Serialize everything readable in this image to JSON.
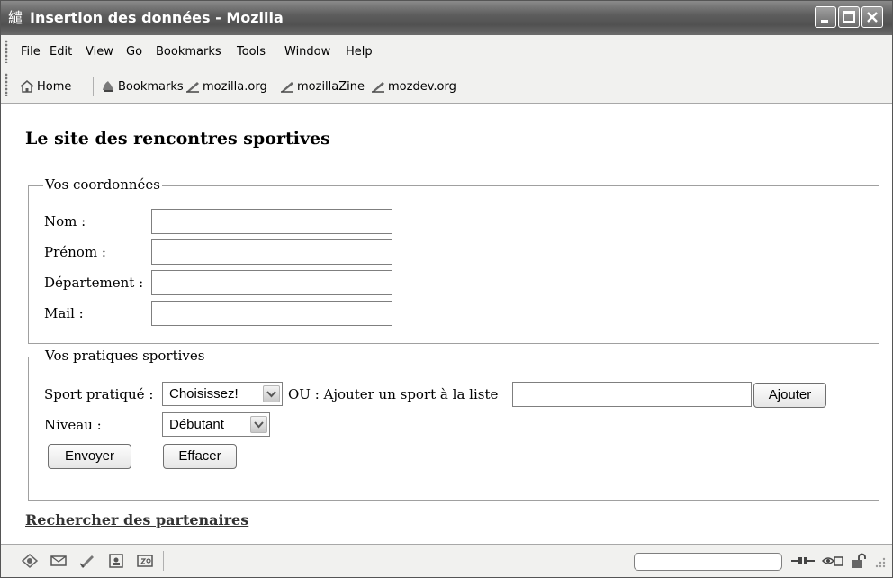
{
  "window": {
    "title": "Insertion des données - Mozilla"
  },
  "menubar": {
    "items": [
      "File",
      "Edit",
      "View",
      "Go",
      "Bookmarks",
      "Tools",
      "Window",
      "Help"
    ]
  },
  "toolbar": {
    "home": "Home",
    "bookmarks": "Bookmarks",
    "links": [
      "mozilla.org",
      "mozillaZine",
      "mozdev.org"
    ]
  },
  "page": {
    "title": "Le site des rencontres sportives",
    "coords": {
      "legend": "Vos coordonnées",
      "nom_label": "Nom :",
      "prenom_label": "Prénom :",
      "departement_label": "Département :",
      "mail_label": "Mail :"
    },
    "sports": {
      "legend": "Vos pratiques sportives",
      "sport_label": "Sport pratiqué :",
      "sport_selected": "Choisissez!",
      "ou_label": "OU : Ajouter un sport à la liste",
      "ajouter_button": "Ajouter",
      "niveau_label": "Niveau :",
      "niveau_selected": "Débutant",
      "envoyer_button": "Envoyer",
      "effacer_button": "Effacer"
    },
    "search_link": "Rechercher des partenaires"
  },
  "icons": {
    "app": "mozilla-app-icon",
    "statusbar": [
      "navigator-icon",
      "mail-icon",
      "composer-icon",
      "address-book-icon",
      "irc-chat-icon"
    ],
    "status_right": [
      "online-plug-icon",
      "popup-blocker-icon",
      "security-lock-icon"
    ]
  },
  "colors": {
    "titlebar": "#5e5e5e",
    "chrome": "#f1f1ef",
    "link": "#333333"
  }
}
